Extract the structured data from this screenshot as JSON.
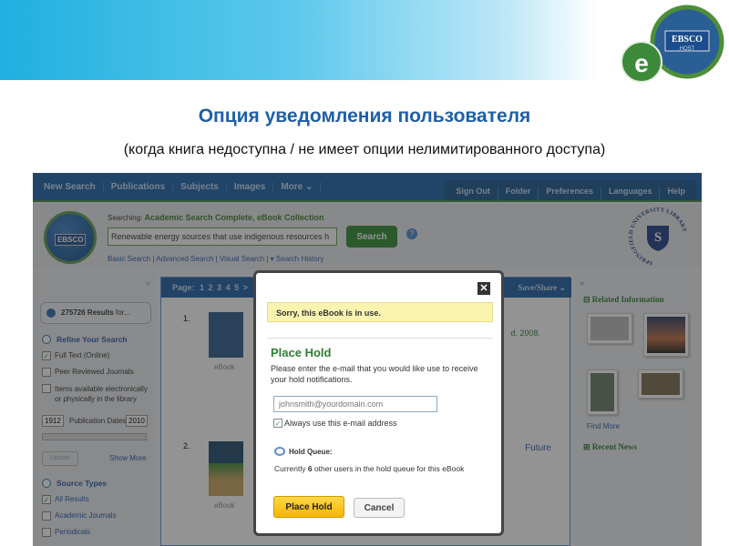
{
  "slide": {
    "title": "Опция уведомления пользователя",
    "subtitle": "(когда книга недоступна / не имеет опции нелимитированного доступа)",
    "logo_text": "EBSCO HOST"
  },
  "nav": {
    "left": [
      "New Search",
      "Publications",
      "Subjects",
      "Images",
      "More ⌄"
    ],
    "right": [
      "Sign Out",
      "Folder",
      "Preferences",
      "Languages",
      "Help"
    ]
  },
  "header": {
    "searching_label": "Searching:",
    "databases": "Academic Search Complete, eBook Collection",
    "query": "Renewable energy sources that use indigenous resources h",
    "search_button": "Search",
    "links": [
      "Basic Search",
      "Advanced Search",
      "Visual Search",
      "▾ Search History"
    ],
    "logo_text": "EBSCO",
    "university": "SPRINGFIELD UNIVERSITY LIBRARY"
  },
  "left": {
    "collapse": "«",
    "results_count": "275726 Results",
    "results_for": " for...",
    "refine_title": "Refine Your Search",
    "filters": [
      {
        "label": "Full Text (Online)",
        "checked": true
      },
      {
        "label": "Peer Reviewed Journals",
        "checked": false
      },
      {
        "label": "Items available electronically or physically in the library",
        "checked": false
      }
    ],
    "date_from": "1912",
    "date_label": "Publication Dates",
    "date_to": "2010",
    "update": "Update",
    "show_more": "Show More",
    "source_title": "Source Types",
    "sources": [
      {
        "label": "All Results",
        "checked": true
      },
      {
        "label": "Academic Journals",
        "checked": false
      },
      {
        "label": "Periodicals",
        "checked": false
      }
    ]
  },
  "main": {
    "page_label": "Page:",
    "pages": [
      "1",
      "2",
      "3",
      "4",
      "5",
      ">"
    ],
    "save_share": "Save/Share ⌄",
    "results": [
      {
        "num": "1.",
        "type": "eBook",
        "snippet": "d. 2008."
      },
      {
        "num": "2.",
        "type": "eBook",
        "snippet": "Future"
      }
    ]
  },
  "right": {
    "expand": "»",
    "related": "Related Information",
    "find_more": "Find More",
    "recent_news": "Recent News"
  },
  "modal": {
    "close": "✕",
    "alert": "Sorry, this eBook is in use.",
    "title": "Place Hold",
    "description": "Please enter the e-mail that you would like use to receive your hold notifications.",
    "email_placeholder": "johnsmith@yourdomain.com",
    "always_label": "Always use this e-mail address",
    "always_checked": true,
    "queue_title": "Hold Queue:",
    "queue_pre": "Currently ",
    "queue_count": "6",
    "queue_post": " other users in the hold queue for this eBook",
    "place_hold": "Place Hold",
    "cancel": "Cancel"
  }
}
